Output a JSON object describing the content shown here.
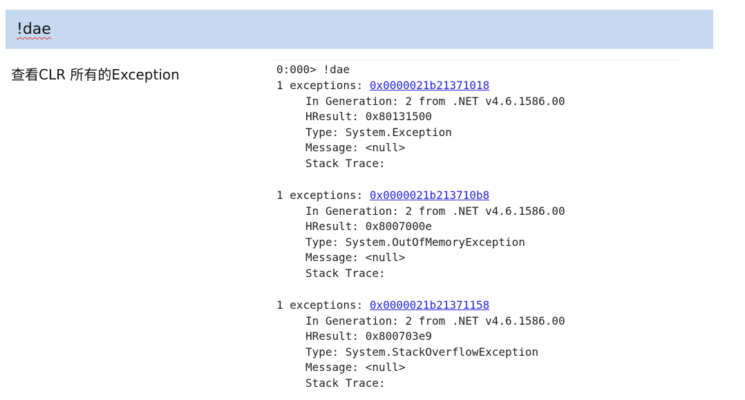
{
  "header": {
    "title": "!dae"
  },
  "description": "查看CLR 所有的Exception",
  "console": {
    "prompt_line": "0:000> !dae",
    "exceptions": [
      {
        "prefix": "1 exceptions: ",
        "address": "0x0000021b21371018",
        "generation": "In Generation: 2 from .NET v4.6.1586.00",
        "hresult": "HResult: 0x80131500",
        "type": "Type: System.Exception",
        "message": "Message: <null>",
        "stack_trace": "Stack Trace:"
      },
      {
        "prefix": "1 exceptions: ",
        "address": "0x0000021b213710b8",
        "generation": "In Generation: 2 from .NET v4.6.1586.00",
        "hresult": "HResult: 0x8007000e",
        "type": "Type: System.OutOfMemoryException",
        "message": "Message: <null>",
        "stack_trace": "Stack Trace:"
      },
      {
        "prefix": "1 exceptions: ",
        "address": "0x0000021b21371158",
        "generation": "In Generation: 2 from .NET v4.6.1586.00",
        "hresult": "HResult: 0x800703e9",
        "type": "Type: System.StackOverflowException",
        "message": "Message: <null>",
        "stack_trace": "Stack Trace:"
      }
    ]
  }
}
